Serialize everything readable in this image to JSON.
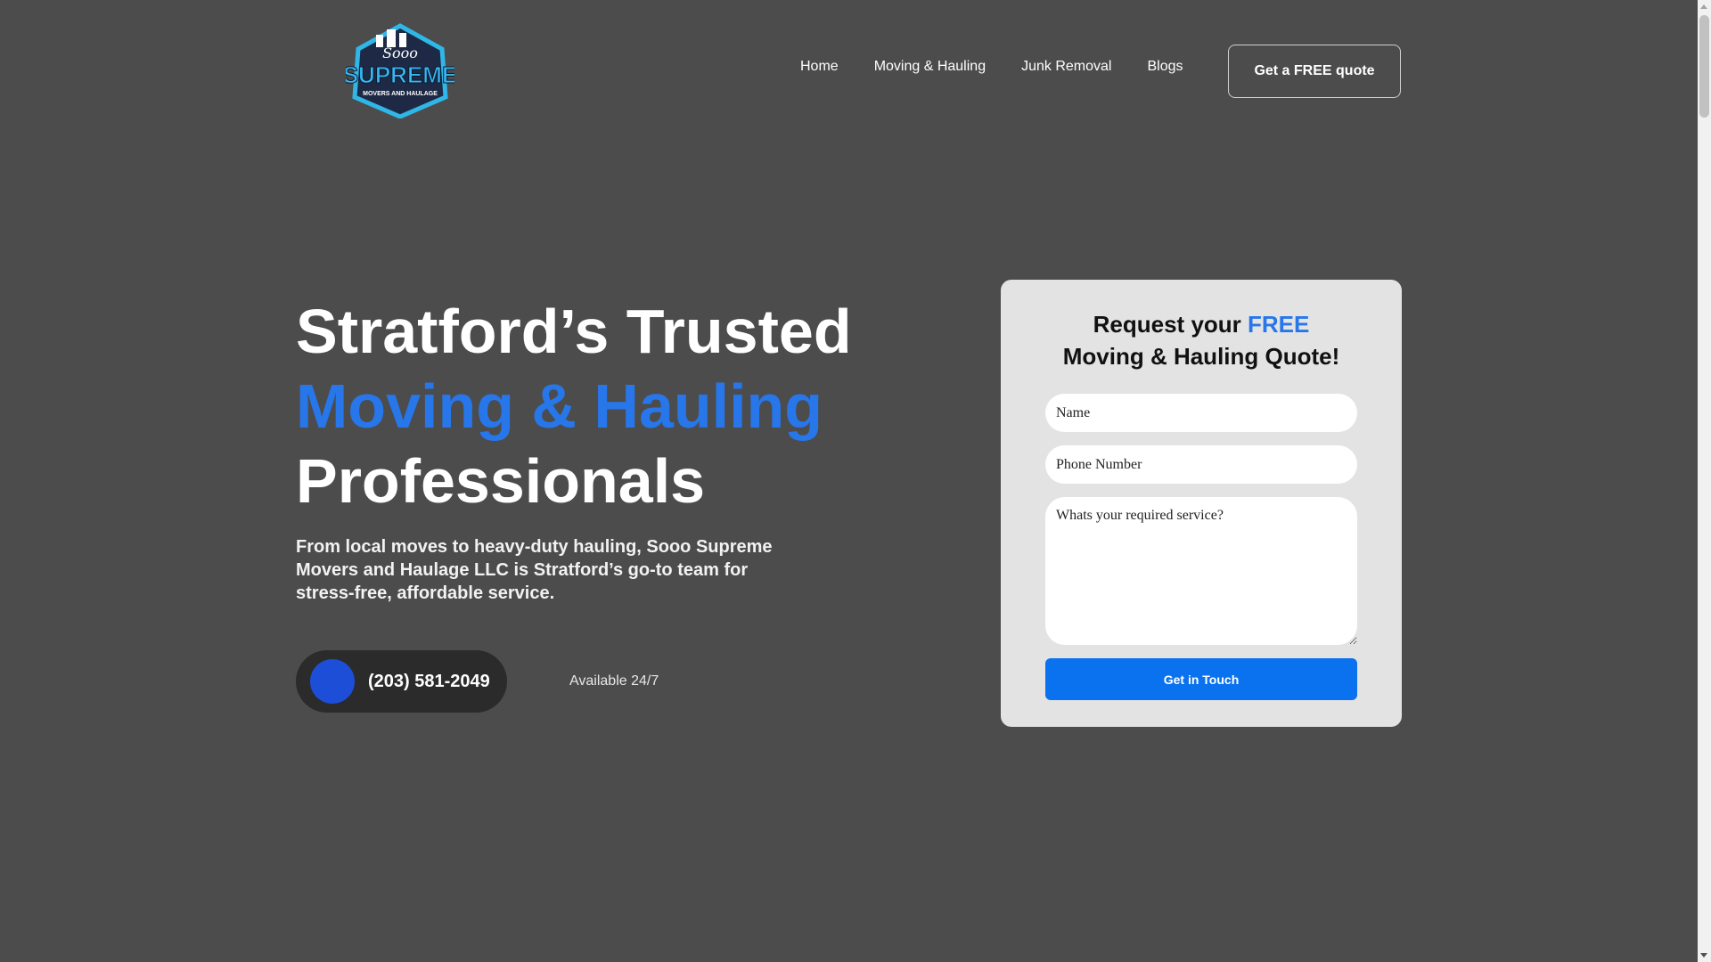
{
  "header": {
    "logo_top_text": "Sooo",
    "logo_main_text": "SUPREME",
    "logo_sub_text": "MOVERS AND HAULAGE",
    "nav": [
      "Home",
      "Moving & Hauling",
      "Junk Removal",
      "Blogs"
    ],
    "cta_label": "Get a FREE quote"
  },
  "hero": {
    "title_line1": "Stratford’s Trusted",
    "title_line2": "Moving & Hauling",
    "title_line3": "Professionals",
    "subtitle": "From local moves to heavy-duty hauling, Sooo Supreme Movers and Haulage LLC is Stratford’s go-to team for stress-free, affordable service.",
    "phone": "(203) 581-2049",
    "availability": "Available 24/7"
  },
  "form": {
    "title_prefix": "Request your ",
    "title_accent": "FREE",
    "title_line2": "Moving & Hauling Quote!",
    "name_placeholder": "Name",
    "phone_placeholder": "Phone Number",
    "service_placeholder": "Whats your required service?",
    "submit_label": "Get in Touch"
  },
  "colors": {
    "background": "#4c4c4c",
    "accent": "#2776ea",
    "submit": "#0a72ee",
    "card": "#e3e3e3"
  }
}
